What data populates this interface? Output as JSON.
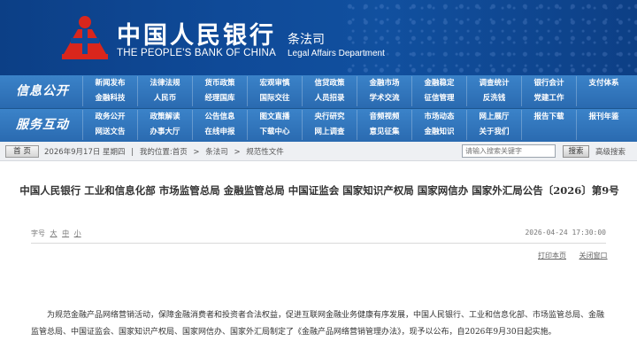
{
  "header": {
    "title_cn": "中国人民银行",
    "title_en": "THE PEOPLE'S BANK OF CHINA",
    "dept_cn": "条法司",
    "dept_en": "Legal Affairs Department",
    "logo_icon": "pboc-logo-icon",
    "colors": {
      "header_bg": "#0f4a98",
      "logo_red": "#d9261c",
      "nav_bg": "#2b6db5"
    }
  },
  "nav": {
    "row1": {
      "label": "信息公开",
      "items": [
        "新闻发布",
        "法律法规",
        "货币政策",
        "宏观审慎",
        "信贷政策",
        "金融市场",
        "金融稳定",
        "调查统计",
        "银行会计",
        "支付体系",
        "金融科技",
        "人民币",
        "经理国库",
        "国际交往",
        "人员招录",
        "学术交流",
        "征信管理",
        "反洗钱",
        "党建工作",
        ""
      ]
    },
    "row2": {
      "label": "服务互动",
      "items": [
        "政务公开",
        "政策解读",
        "公告信息",
        "图文直播",
        "央行研究",
        "音频视频",
        "市场动态",
        "网上展厅",
        "报告下载",
        "报刊年鉴",
        "网送文告",
        "办事大厅",
        "在线申报",
        "下载中心",
        "网上调查",
        "意见征集",
        "金融知识",
        "关于我们",
        "",
        ""
      ]
    }
  },
  "breadcrumb": {
    "home_label": "首 页",
    "date": "2026年9月17日 星期四",
    "sep": "|",
    "location_prefix": "我的位置:首页",
    "arrow": ">",
    "level1": "条法司",
    "level2": "规范性文件",
    "search_placeholder": "请输入搜索关键字",
    "search_button": "搜索",
    "advanced_search": "高级搜索"
  },
  "article": {
    "title": "中国人民银行 工业和信息化部 市场监管总局 金融监管总局 中国证监会 国家知识产权局 国家网信办 国家外汇局公告〔2026〕第9号",
    "font_size_label": "字号",
    "font_sizes": [
      "大",
      "中",
      "小"
    ],
    "publish_datetime": "2026-04-24 17:30:00",
    "print_label": "打印本页",
    "close_label": "关闭窗口",
    "body": "为规范金融产品网络营销活动，保障金融消费者和投资者合法权益，促进互联网金融业务健康有序发展，中国人民银行、工业和信息化部、市场监管总局、金融监管总局、中国证监会、国家知识产权局、国家网信办、国家外汇局制定了《金融产品网络营销管理办法》，现予以公布，自2026年9月30日起实施。"
  }
}
